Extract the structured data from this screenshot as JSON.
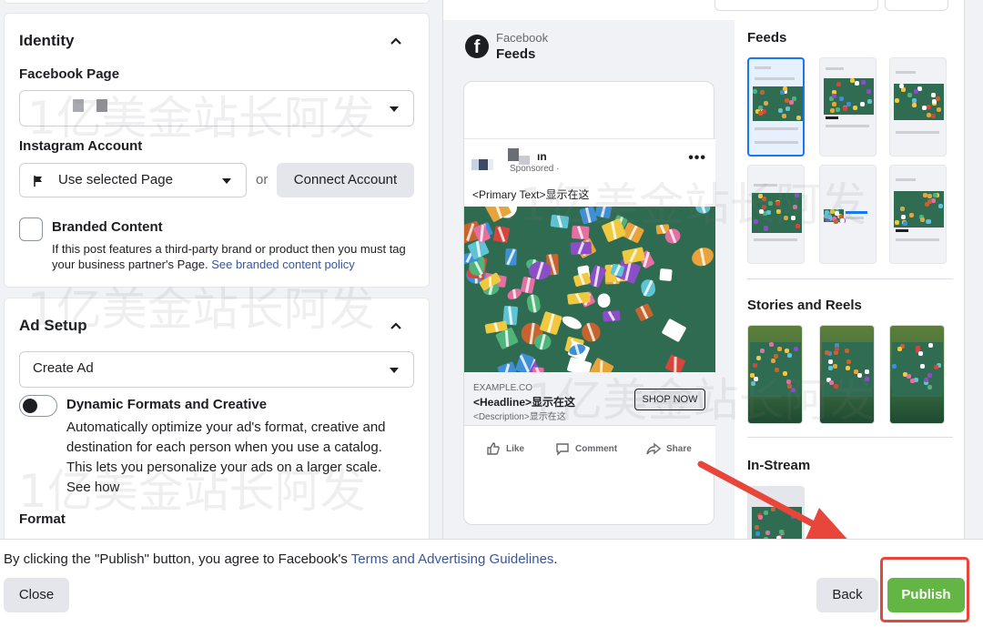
{
  "identity": {
    "title": "Identity",
    "facebook_page_label": "Facebook Page",
    "instagram_label": "Instagram Account",
    "instagram_value": "Use selected Page",
    "or_text": "or",
    "connect_button": "Connect Account",
    "branded_title": "Branded Content",
    "branded_desc_1": "If this post features a third-party brand or product then you must tag",
    "branded_desc_2": "your business partner's Page.",
    "branded_link": "See branded content policy"
  },
  "ad_setup": {
    "title": "Ad Setup",
    "create_value": "Create Ad",
    "dynamic_title": "Dynamic Formats and Creative",
    "dynamic_desc_1": "Automatically optimize your ad's format, creative and",
    "dynamic_desc_2": "destination for each person when you use a catalog.",
    "dynamic_desc_3": "This lets you personalize your ads on a larger scale.",
    "see_how": "See how",
    "format_label": "Format"
  },
  "preview": {
    "platform": "Facebook",
    "placement": "Feeds",
    "post_name": "ın",
    "sponsored": "Sponsored · ",
    "primary_text": "<Primary Text>显示在这",
    "domain": "EXAMPLE.CO",
    "headline": "<Headline>显示在这",
    "description": "<Description>显示在这",
    "cta": "SHOP NOW",
    "like": "Like",
    "comment": "Comment",
    "share": "Share"
  },
  "placements": {
    "feeds_title": "Feeds",
    "stories_title": "Stories and Reels",
    "instream_title": "In-Stream"
  },
  "footer": {
    "agree_text": "By clicking the \"Publish\" button, you agree to Facebook's ",
    "terms_link": "Terms and Advertising Guidelines",
    "period": ".",
    "close": "Close",
    "back": "Back",
    "publish": "Publish"
  },
  "watermark": "1亿美金站长阿发",
  "colors": {
    "publish_green": "#63b544",
    "link_blue": "#385898",
    "highlight_red": "#e8453b",
    "selected_blue": "#1877f2"
  }
}
